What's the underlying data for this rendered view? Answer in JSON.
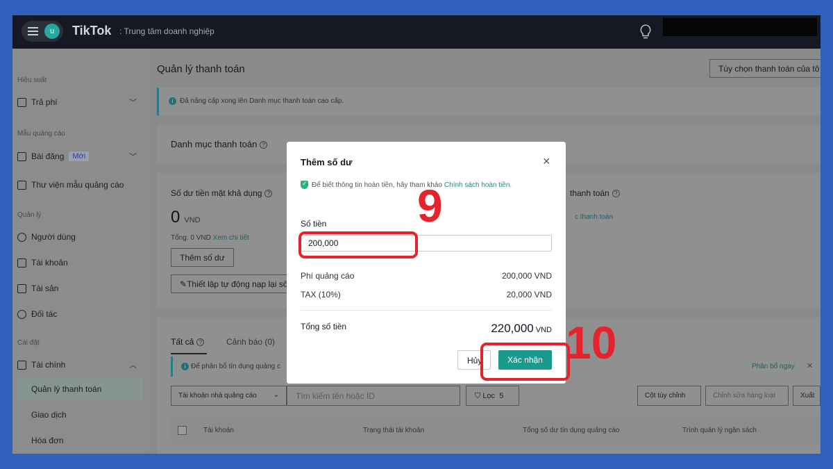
{
  "header": {
    "avatar_letter": "u",
    "logo": "TikTok",
    "subtitle": ": Trung tâm doanh nghiệp"
  },
  "sidebar": {
    "sections": [
      "Hiệu suất",
      "Mẫu quảng cáo",
      "Quản lý",
      "Cài đặt"
    ],
    "items": [
      {
        "label": "Trả phí"
      },
      {
        "label": "Bài đăng",
        "badge": "Mới"
      },
      {
        "label": "Thư viện mẫu quảng cáo"
      },
      {
        "label": "Người dùng"
      },
      {
        "label": "Tài khoản"
      },
      {
        "label": "Tài sản"
      },
      {
        "label": "Đối tác"
      },
      {
        "label": "Tài chính"
      }
    ],
    "sub_items": [
      "Quản lý thanh toán",
      "Giao dịch",
      "Hóa đơn"
    ]
  },
  "main": {
    "title": "Quản lý thanh toán",
    "options_button": "Tùy chọn thanh toán của tô",
    "info_banner": "Đã nâng cấp xong lên Danh mục thanh toán cao cấp.",
    "catalog_title": "Danh mục thanh toán",
    "balance": {
      "title": "Số dư tiền mặt khả dụng",
      "amount": "0",
      "currency": "VND",
      "total_prefix": "Tổng: 0 VND",
      "view_details": "Xem chi tiết",
      "add_button": "Thêm số dư",
      "auto_button": "Thiết lập tự động nạp lại số"
    },
    "right_panel": {
      "title": "thanh toán",
      "link": "c thanh toán"
    },
    "tabs": [
      {
        "label": "Tất cả"
      },
      {
        "label": "Cảnh báo (0)"
      }
    ],
    "alloc_banner": {
      "text": "Để phân bổ tín dụng quảng c",
      "link": "Phân bổ ngay"
    },
    "filters": {
      "account_select": "Tài khoản nhà quảng cáo",
      "search_placeholder": "Tìm kiếm tên hoặc ID",
      "filter_label": "Lọc",
      "filter_count": "5",
      "custom_columns": "Cột tùy chỉnh",
      "bulk_edit": "Chỉnh sửa hàng loạt",
      "export": "Xuất"
    },
    "table_headers": [
      "Tài khoản",
      "Trạng thái tài khoản",
      "Tổng số dư tín dụng quảng cáo",
      "Trình quản lý ngân sách"
    ]
  },
  "modal": {
    "title": "Thêm số dư",
    "note": "Để biết thông tin hoàn tiền, hãy tham khảo",
    "policy_link": "Chính sách hoàn tiền.",
    "amount_label": "Số tiền",
    "amount_value": "200,000",
    "rows": [
      {
        "label": "Phí quảng cáo",
        "value": "200,000 VND"
      },
      {
        "label": "TAX (10%)",
        "value": "20,000 VND"
      }
    ],
    "total_label": "Tổng số tiền",
    "total_value": "220,000",
    "total_currency": "VND",
    "cancel": "Hủy",
    "confirm": "Xác nhận"
  },
  "annotations": {
    "step_input": "9",
    "step_confirm": "10",
    "color": "#e4232d"
  },
  "colors": {
    "accent": "#1a9a8c",
    "topbar": "#161823",
    "background": "#2f5fbf"
  }
}
